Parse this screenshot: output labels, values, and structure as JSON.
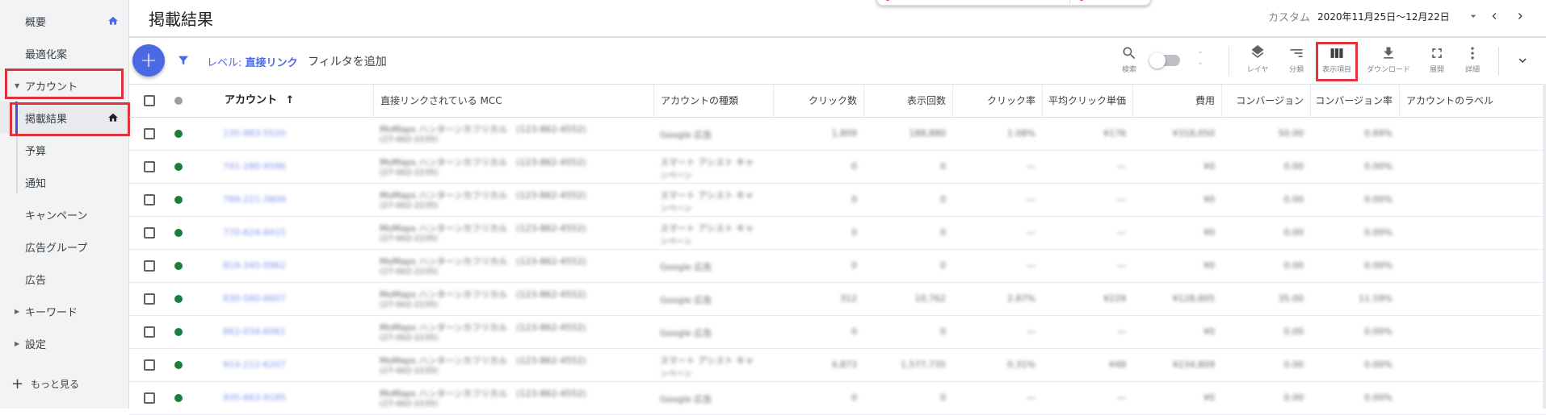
{
  "sidebar": {
    "items": [
      {
        "label": "概要",
        "has_home": true,
        "caret": false,
        "active": false
      },
      {
        "label": "最適化案",
        "has_home": false,
        "caret": false,
        "active": false
      },
      {
        "label": "アカウント",
        "has_home": false,
        "caret": "down",
        "active": false
      },
      {
        "label": "掲載結果",
        "has_home": true,
        "caret": false,
        "active": true
      },
      {
        "label": "予算",
        "has_home": false,
        "caret": false,
        "active": false
      },
      {
        "label": "通知",
        "has_home": false,
        "caret": false,
        "active": false
      },
      {
        "label": "キャンペーン",
        "has_home": false,
        "caret": false,
        "active": false
      },
      {
        "label": "広告グループ",
        "has_home": false,
        "caret": false,
        "active": false
      },
      {
        "label": "広告",
        "has_home": false,
        "caret": false,
        "active": false
      },
      {
        "label": "キーワード",
        "has_home": false,
        "caret": "right",
        "active": false
      },
      {
        "label": "設定",
        "has_home": false,
        "caret": "right",
        "active": false
      }
    ],
    "more": {
      "icon": "+",
      "label": "もっと見る"
    }
  },
  "header": {
    "title": "掲載結果",
    "date_preset": "カスタム",
    "date_range": "2020年11月25日～12月22日"
  },
  "toolbar": {
    "add_icon": "+",
    "level_label": "レベル:",
    "level_value": "直接リンク",
    "add_filter": "フィルタを追加",
    "search_label": "検索",
    "segment_label": "レイヤ",
    "breakdown_label": "分類",
    "columns_label": "表示項目",
    "download_label": "ダウンロード",
    "expand_label": "展開",
    "more_label": "詳細"
  },
  "table": {
    "columns": [
      "アカウント",
      "直接リンクされている MCC",
      "アカウントの種類",
      "クリック数",
      "表示回数",
      "クリック率",
      "平均クリック単価",
      "費用",
      "コンバージョン",
      "コンバージョン率",
      "アカウントのラベル"
    ],
    "sort_indicator": "↑",
    "rows": [
      {
        "account": "135-983-5520",
        "mcc1": "MoMaps ハンターンカフリカル　(123-862-4552)",
        "mcc2": "(27-002-2235)",
        "type1": "Google 広告",
        "type2": "",
        "clicks": "1,809",
        "impr": "188,880",
        "ctr": "1.08%",
        "cpc": "¥176",
        "cost": "¥318,050",
        "conv": "50.00",
        "convrate": "0.69%"
      },
      {
        "account": "741-280-9596",
        "mcc1": "MoMaps ハンターンカフリカル　(123-862-4552)",
        "mcc2": "(27-002-2235)",
        "type1": "スマート アシスト キャ",
        "type2": "ンペーン",
        "clicks": "0",
        "impr": "0",
        "ctr": "—",
        "cpc": "—",
        "cost": "¥0",
        "conv": "0.00",
        "convrate": "0.00%"
      },
      {
        "account": "799-221-3809",
        "mcc1": "MoMaps ハンターンカフリカル　(123-862-4552)",
        "mcc2": "(27-002-2235)",
        "type1": "スマート アシスト キャ",
        "type2": "ンペーン",
        "clicks": "0",
        "impr": "0",
        "ctr": "—",
        "cpc": "—",
        "cost": "¥0",
        "conv": "0.00",
        "convrate": "0.00%"
      },
      {
        "account": "770-624-8415",
        "mcc1": "MoMaps ハンターンカフリカル　(123-862-4552)",
        "mcc2": "(27-002-2235)",
        "type1": "スマート アシスト キャ",
        "type2": "ンペーン",
        "clicks": "0",
        "impr": "0",
        "ctr": "—",
        "cpc": "—",
        "cost": "¥0",
        "conv": "0.00",
        "convrate": "0.00%"
      },
      {
        "account": "819-345-0962",
        "mcc1": "MoMaps ハンターンカフリカル　(123-862-4552)",
        "mcc2": "(27-002-2235)",
        "type1": "Google 広告",
        "type2": "",
        "clicks": "0",
        "impr": "0",
        "ctr": "—",
        "cpc": "—",
        "cost": "¥0",
        "conv": "0.00",
        "convrate": "0.00%"
      },
      {
        "account": "830-580-6607",
        "mcc1": "MoMaps ハンターンカフリカル　(123-862-4552)",
        "mcc2": "(27-002-2235)",
        "type1": "Google 広告",
        "type2": "",
        "clicks": "312",
        "impr": "10,762",
        "ctr": "2.87%",
        "cpc": "¥229",
        "cost": "¥128,605",
        "conv": "35.00",
        "convrate": "11.59%"
      },
      {
        "account": "862-034-6061",
        "mcc1": "MoMaps ハンターンカフリカル　(123-862-4552)",
        "mcc2": "(27-002-2235)",
        "type1": "Google 広告",
        "type2": "",
        "clicks": "0",
        "impr": "0",
        "ctr": "—",
        "cpc": "—",
        "cost": "¥0",
        "conv": "0.00",
        "convrate": "0.00%"
      },
      {
        "account": "914-212-6207",
        "mcc1": "MoMaps ハンターンカフリカル　(123-862-4552)",
        "mcc2": "(27-002-2235)",
        "type1": "スマート アシスト キャ",
        "type2": "ンペーン",
        "clicks": "4,873",
        "impr": "1,577,735",
        "ctr": "0.31%",
        "cpc": "¥48",
        "cost": "¥234,809",
        "conv": "0.00",
        "convrate": "0.00%"
      },
      {
        "account": "935-663-9185",
        "mcc1": "MoMaps ハンターンカフリカル　(123-862-4552)",
        "mcc2": "(27-002-2235)",
        "type1": "Google 広告",
        "type2": "",
        "clicks": "0",
        "impr": "0",
        "ctr": "—",
        "cpc": "—",
        "cost": "¥0",
        "conv": "0.00",
        "convrate": "0.00%"
      }
    ]
  },
  "colors": {
    "accent": "#4a69e2",
    "highlight_box": "#e0323a",
    "status_green": "#188038"
  }
}
